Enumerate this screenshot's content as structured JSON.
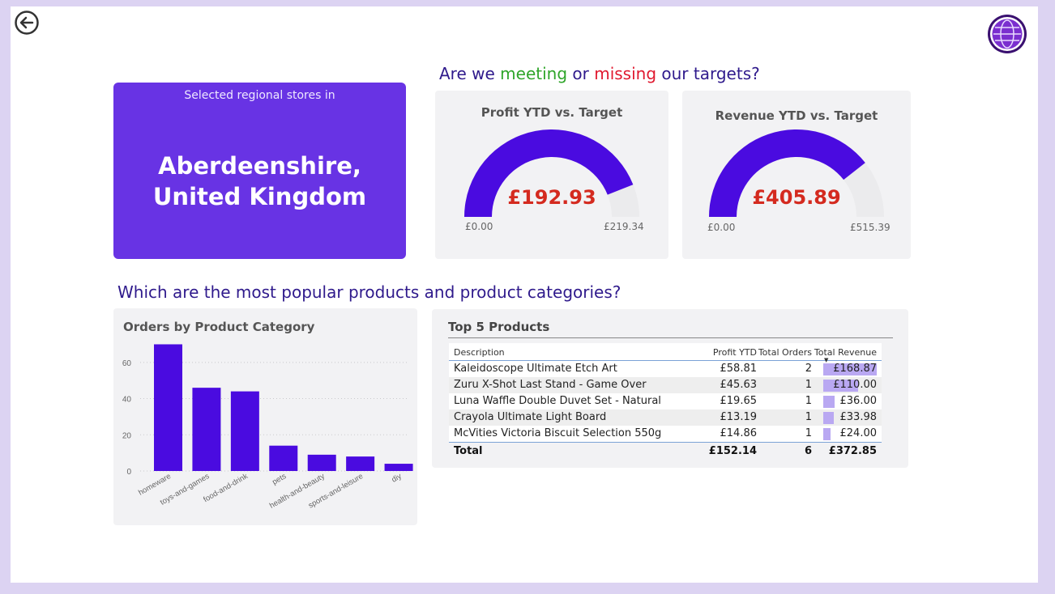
{
  "nav": {
    "back_icon": "back-arrow-icon",
    "logo_icon": "globe-logo-icon"
  },
  "headline_targets": {
    "part1": "Are we ",
    "meeting": "meeting",
    "part2": " or ",
    "missing": "missing",
    "part3": " our targets?"
  },
  "headline_products": "Which are the most popular products and product categories?",
  "region": {
    "subtitle": "Selected regional stores in",
    "name": "Aberdeenshire, United Kingdom"
  },
  "gauges": [
    {
      "title": "Profit YTD vs. Target",
      "value": "£192.93",
      "min": "£0.00",
      "max": "£219.34",
      "fraction": 0.8796
    },
    {
      "title": "Revenue YTD vs. Target",
      "value": "£405.89",
      "min": "£0.00",
      "max": "£515.39",
      "fraction": 0.7875
    }
  ],
  "colors": {
    "accent": "#4a0be0",
    "region_card": "#6833e4",
    "value_red": "#d42a1f",
    "meeting_green": "#2fa52a",
    "missing_red": "#e0192f",
    "bar_fill": "#b9a8f2"
  },
  "chart_data": {
    "type": "bar",
    "title": "Orders by Product Category",
    "categories": [
      "homeware",
      "toys-and-games",
      "food-and-drink",
      "pets",
      "health-and-beauty",
      "sports-and-leisure",
      "diy"
    ],
    "values": [
      70,
      46,
      44,
      14,
      9,
      8,
      4
    ],
    "yticks": [
      0,
      20,
      40,
      60
    ],
    "ylim": [
      0,
      72
    ],
    "grid": true
  },
  "top_products": {
    "title": "Top 5 Products",
    "headers": {
      "description": "Description",
      "profit": "Profit YTD",
      "orders": "Total Orders",
      "revenue": "Total Revenue"
    },
    "rows": [
      {
        "description": "Kaleidoscope Ultimate Etch Art",
        "profit": "£58.81",
        "orders": "2",
        "revenue": "£168.87",
        "revenue_value": 168.87
      },
      {
        "description": "Zuru X-Shot Last Stand - Game Over",
        "profit": "£45.63",
        "orders": "1",
        "revenue": "£110.00",
        "revenue_value": 110.0
      },
      {
        "description": "Luna Waffle Double Duvet Set - Natural",
        "profit": "£19.65",
        "orders": "1",
        "revenue": "£36.00",
        "revenue_value": 36.0
      },
      {
        "description": "Crayola Ultimate Light Board",
        "profit": "£13.19",
        "orders": "1",
        "revenue": "£33.98",
        "revenue_value": 33.98
      },
      {
        "description": "McVities Victoria Biscuit Selection 550g",
        "profit": "£14.86",
        "orders": "1",
        "revenue": "£24.00",
        "revenue_value": 24.0
      }
    ],
    "total": {
      "label": "Total",
      "profit": "£152.14",
      "orders": "6",
      "revenue": "£372.85"
    }
  }
}
